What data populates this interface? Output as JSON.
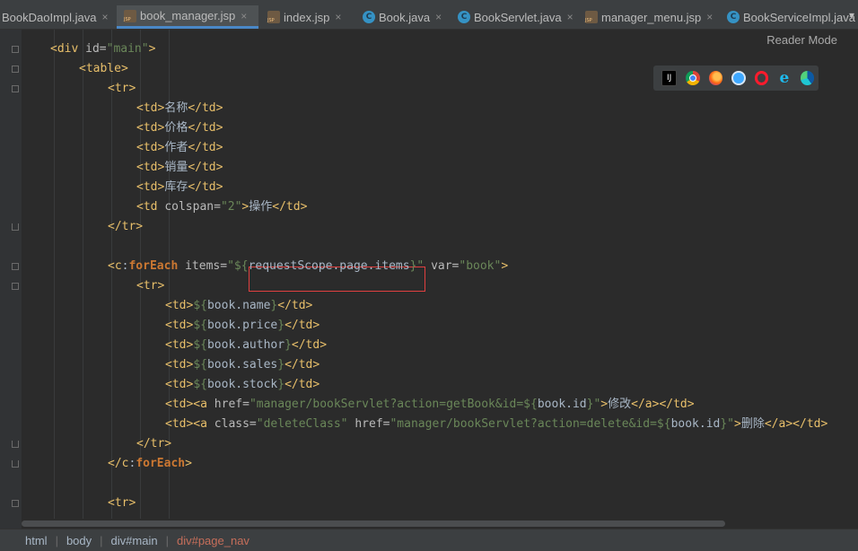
{
  "tabs": [
    {
      "label": "BookDaoImpl.java",
      "type": "none",
      "active": false,
      "close": "×"
    },
    {
      "label": "book_manager.jsp",
      "type": "jsp",
      "active": true,
      "close": "×"
    },
    {
      "label": "index.jsp",
      "type": "jsp",
      "active": false,
      "close": "×"
    },
    {
      "label": "Book.java",
      "type": "java",
      "active": false,
      "close": "×"
    },
    {
      "label": "BookServlet.java",
      "type": "java",
      "active": false,
      "close": "×"
    },
    {
      "label": "manager_menu.jsp",
      "type": "jsp",
      "active": false,
      "close": "×"
    },
    {
      "label": "BookServiceImpl.java",
      "type": "java",
      "active": false,
      "close": ""
    }
  ],
  "tab_overflow": "▾",
  "reader_mode": "Reader Mode",
  "browsers": [
    "intellij-icon",
    "chrome-icon",
    "firefox-icon",
    "safari-icon",
    "opera-icon",
    "ie-icon",
    "edge-icon"
  ],
  "code_lines": [
    {
      "indent": 1,
      "tokens": [
        [
          "tag",
          "<div "
        ],
        [
          "attr",
          "id="
        ],
        [
          "str",
          "\"main\""
        ],
        [
          "tag",
          ">"
        ]
      ]
    },
    {
      "indent": 2,
      "tokens": [
        [
          "tag",
          "<table>"
        ]
      ]
    },
    {
      "indent": 3,
      "tokens": [
        [
          "tag",
          "<tr>"
        ]
      ]
    },
    {
      "indent": 4,
      "tokens": [
        [
          "tag",
          "<td>"
        ],
        [
          "cjk",
          "名称"
        ],
        [
          "tag",
          "</td>"
        ]
      ]
    },
    {
      "indent": 4,
      "tokens": [
        [
          "tag",
          "<td>"
        ],
        [
          "cjk",
          "价格"
        ],
        [
          "tag",
          "</td>"
        ]
      ]
    },
    {
      "indent": 4,
      "tokens": [
        [
          "tag",
          "<td>"
        ],
        [
          "cjk",
          "作者"
        ],
        [
          "tag",
          "</td>"
        ]
      ]
    },
    {
      "indent": 4,
      "tokens": [
        [
          "tag",
          "<td>"
        ],
        [
          "cjk",
          "销量"
        ],
        [
          "tag",
          "</td>"
        ]
      ]
    },
    {
      "indent": 4,
      "tokens": [
        [
          "tag",
          "<td>"
        ],
        [
          "cjk",
          "库存"
        ],
        [
          "tag",
          "</td>"
        ]
      ]
    },
    {
      "indent": 4,
      "tokens": [
        [
          "tag",
          "<td "
        ],
        [
          "attr",
          "colspan="
        ],
        [
          "str",
          "\"2\""
        ],
        [
          "tag",
          ">"
        ],
        [
          "cjk",
          "操作"
        ],
        [
          "tag",
          "</td>"
        ]
      ]
    },
    {
      "indent": 3,
      "tokens": [
        [
          "tag",
          "</tr>"
        ]
      ]
    },
    {
      "indent": 0,
      "tokens": []
    },
    {
      "indent": 3,
      "tokens": [
        [
          "tag",
          "<c"
        ],
        [
          "plain",
          ":"
        ],
        [
          "kw",
          "forEach "
        ],
        [
          "attr",
          "items="
        ],
        [
          "str",
          "\"${"
        ],
        [
          "el",
          "requestScope.page.items"
        ],
        [
          "str",
          "}\" "
        ],
        [
          "attr",
          "var="
        ],
        [
          "str",
          "\"book\""
        ],
        [
          "tag",
          ">"
        ]
      ]
    },
    {
      "indent": 4,
      "tokens": [
        [
          "tag",
          "<tr>"
        ]
      ]
    },
    {
      "indent": 5,
      "tokens": [
        [
          "tag",
          "<td>"
        ],
        [
          "str",
          "${"
        ],
        [
          "el",
          "book.name"
        ],
        [
          "str",
          "}"
        ],
        [
          "tag",
          "</td>"
        ]
      ]
    },
    {
      "indent": 5,
      "tokens": [
        [
          "tag",
          "<td>"
        ],
        [
          "str",
          "${"
        ],
        [
          "el",
          "book.price"
        ],
        [
          "str",
          "}"
        ],
        [
          "tag",
          "</td>"
        ]
      ]
    },
    {
      "indent": 5,
      "tokens": [
        [
          "tag",
          "<td>"
        ],
        [
          "str",
          "${"
        ],
        [
          "el",
          "book.author"
        ],
        [
          "str",
          "}"
        ],
        [
          "tag",
          "</td>"
        ]
      ]
    },
    {
      "indent": 5,
      "tokens": [
        [
          "tag",
          "<td>"
        ],
        [
          "str",
          "${"
        ],
        [
          "el",
          "book.sales"
        ],
        [
          "str",
          "}"
        ],
        [
          "tag",
          "</td>"
        ]
      ]
    },
    {
      "indent": 5,
      "tokens": [
        [
          "tag",
          "<td>"
        ],
        [
          "str",
          "${"
        ],
        [
          "el",
          "book.stock"
        ],
        [
          "str",
          "}"
        ],
        [
          "tag",
          "</td>"
        ]
      ]
    },
    {
      "indent": 5,
      "tokens": [
        [
          "tag",
          "<td><a "
        ],
        [
          "attr",
          "href="
        ],
        [
          "str",
          "\"manager/bookServlet?action=getBook&id=${"
        ],
        [
          "el",
          "book.id"
        ],
        [
          "str",
          "}\""
        ],
        [
          "tag",
          ">"
        ],
        [
          "cjk",
          "修改"
        ],
        [
          "tag",
          "</a></td>"
        ]
      ]
    },
    {
      "indent": 5,
      "tokens": [
        [
          "tag",
          "<td><a "
        ],
        [
          "attr",
          "class="
        ],
        [
          "str",
          "\"deleteClass\" "
        ],
        [
          "attr",
          "href="
        ],
        [
          "str",
          "\"manager/bookServlet?action=delete&id=${"
        ],
        [
          "el",
          "book.id"
        ],
        [
          "str",
          "}\""
        ],
        [
          "tag",
          ">"
        ],
        [
          "cjk",
          "删除"
        ],
        [
          "tag",
          "</a></td>"
        ]
      ]
    },
    {
      "indent": 4,
      "tokens": [
        [
          "tag",
          "</tr>"
        ]
      ]
    },
    {
      "indent": 3,
      "tokens": [
        [
          "tag",
          "</c"
        ],
        [
          "plain",
          ":"
        ],
        [
          "kw",
          "forEach"
        ],
        [
          "tag",
          ">"
        ]
      ]
    },
    {
      "indent": 0,
      "tokens": []
    },
    {
      "indent": 3,
      "tokens": [
        [
          "tag",
          "<tr>"
        ]
      ]
    }
  ],
  "breadcrumb": [
    "html",
    "body",
    "div#main",
    "div#page_nav"
  ]
}
